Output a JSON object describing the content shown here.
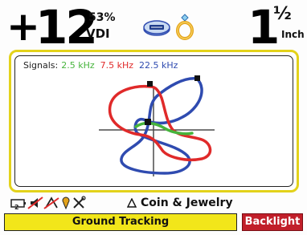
{
  "vdi": {
    "sign": "+",
    "value": "12",
    "percent": "53%",
    "label": "VDI"
  },
  "target": {
    "icon": "coin-target-icon",
    "ring_icon": "gold-ring-icon"
  },
  "depth": {
    "whole": "1",
    "fraction": "½",
    "unit": "Inch"
  },
  "graph": {
    "signals_label": "Signals:",
    "signals": [
      {
        "label": "2.5 kHz",
        "color": "#46b43c"
      },
      {
        "label": "7.5 kHz",
        "color": "#e02a2a"
      },
      {
        "label": "22.5 kHz",
        "color": "#2f4bb0"
      }
    ]
  },
  "status": {
    "icons": [
      "battery-icon",
      "audio-icon",
      "wireless-icon",
      "gps-icon",
      "tools-icon"
    ],
    "mode_icon": "triangle-icon",
    "mode_name": "Coin & Jewelry"
  },
  "bottom": {
    "left_button": "Ground Tracking",
    "right_button": "Backlight"
  },
  "colors": {
    "frame_yellow": "#e3d21a",
    "button_yellow": "#f2e61a",
    "button_red": "#c11f2a"
  }
}
